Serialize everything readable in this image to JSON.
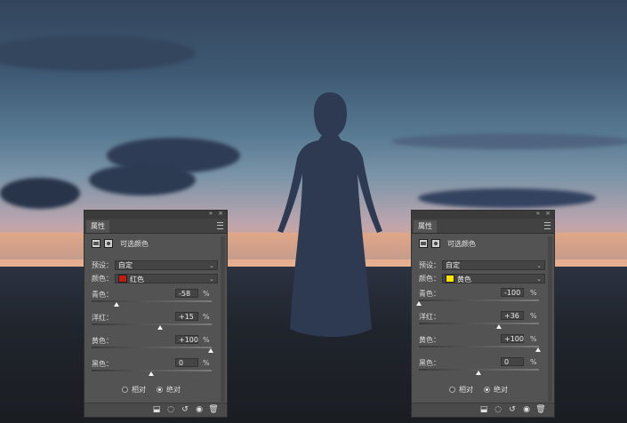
{
  "panels": [
    {
      "tab": "属性",
      "title": "可选颜色",
      "preset_label": "预设：",
      "preset_value": "自定",
      "color_label": "颜色：",
      "color_value": "红色",
      "color_swatch": "#c01d12",
      "sliders": [
        {
          "label": "青色：",
          "value": "-58",
          "unit": "%",
          "level": -58
        },
        {
          "label": "洋红：",
          "value": "+15",
          "unit": "%",
          "level": 15
        },
        {
          "label": "黄色：",
          "value": "+100",
          "unit": "%",
          "level": 100
        },
        {
          "label": "黑色：",
          "value": "0",
          "unit": "%",
          "level": 0
        }
      ],
      "radio_relative": "相对",
      "radio_absolute": "绝对",
      "selected_mode": "absolute"
    },
    {
      "tab": "属性",
      "title": "可选颜色",
      "preset_label": "预设：",
      "preset_value": "自定",
      "color_label": "颜色：",
      "color_value": "黄色",
      "color_swatch": "#ffe400",
      "sliders": [
        {
          "label": "青色：",
          "value": "-100",
          "unit": "%",
          "level": -100
        },
        {
          "label": "洋红：",
          "value": "+36",
          "unit": "%",
          "level": 36
        },
        {
          "label": "黄色：",
          "value": "+100",
          "unit": "%",
          "level": 100
        },
        {
          "label": "黑色：",
          "value": "0",
          "unit": "%",
          "level": 0
        }
      ],
      "radio_relative": "相对",
      "radio_absolute": "绝对",
      "selected_mode": "absolute"
    }
  ],
  "collapse_glyph": "»",
  "close_glyph": "×",
  "colors": {
    "panel_bg": "#535353",
    "panel_header": "#424242"
  }
}
